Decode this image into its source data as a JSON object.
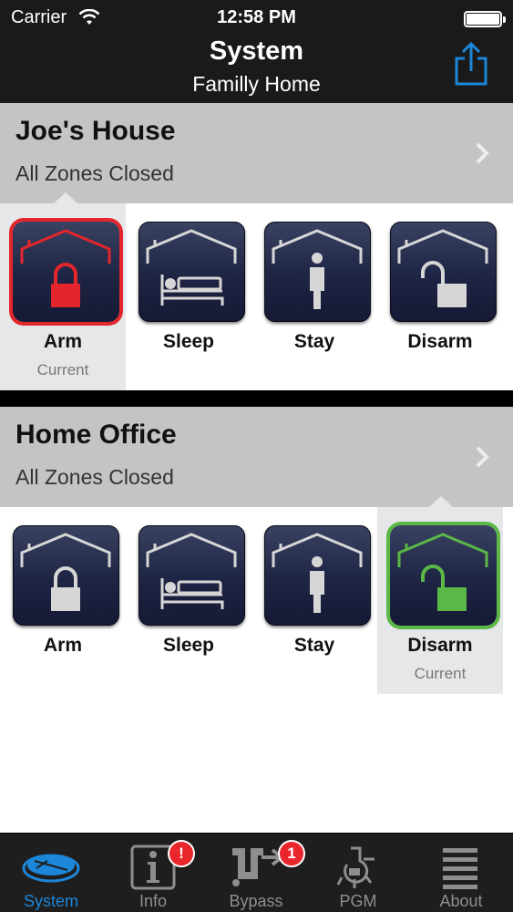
{
  "status_bar": {
    "carrier": "Carrier",
    "time": "12:58 PM"
  },
  "nav": {
    "title": "System",
    "subtitle": "Familly Home",
    "share_icon": "share-icon"
  },
  "panels": [
    {
      "name": "Joe's House",
      "status": "All Zones Closed",
      "modes": [
        {
          "label": "Arm",
          "current": "Current",
          "icon": "arm-lock-icon"
        },
        {
          "label": "Sleep",
          "current": "",
          "icon": "sleep-bed-icon"
        },
        {
          "label": "Stay",
          "current": "",
          "icon": "stay-person-icon"
        },
        {
          "label": "Disarm",
          "current": "",
          "icon": "disarm-unlock-icon"
        }
      ],
      "current_mode": "Arm",
      "current_color": "#e3262b"
    },
    {
      "name": "Home Office",
      "status": "All Zones Closed",
      "modes": [
        {
          "label": "Arm",
          "current": "",
          "icon": "arm-lock-icon"
        },
        {
          "label": "Sleep",
          "current": "",
          "icon": "sleep-bed-icon"
        },
        {
          "label": "Stay",
          "current": "",
          "icon": "stay-person-icon"
        },
        {
          "label": "Disarm",
          "current": "Current",
          "icon": "disarm-unlock-icon"
        }
      ],
      "current_mode": "Disarm",
      "current_color": "#5bb847"
    }
  ],
  "tabbar": {
    "items": [
      {
        "label": "System",
        "icon": "system-panel-icon",
        "badge": "",
        "active": true
      },
      {
        "label": "Info",
        "icon": "info-icon",
        "badge": "!",
        "active": false
      },
      {
        "label": "Bypass",
        "icon": "bypass-icon",
        "badge": "1",
        "active": false
      },
      {
        "label": "PGM",
        "icon": "pgm-lightbulb-icon",
        "badge": "",
        "active": false
      },
      {
        "label": "About",
        "icon": "about-list-icon",
        "badge": "",
        "active": false
      }
    ],
    "active_color": "#1c86d8"
  }
}
